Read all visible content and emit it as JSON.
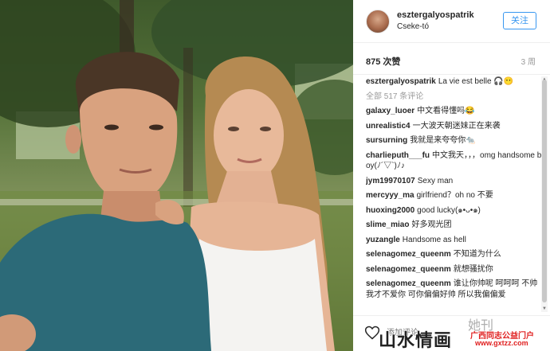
{
  "post": {
    "username": "esztergalyospatrik",
    "location": "Cseke-tó",
    "follow_label": "关注",
    "likes": "875 次赞",
    "time": "3 周"
  },
  "caption": {
    "username": "esztergalyospatrik",
    "text": "La vie est belle 🎧😶"
  },
  "view_all": "全部 517 条评论",
  "comments": [
    {
      "user": "galaxy_luoer",
      "text": "中文看得懂吗😂"
    },
    {
      "user": "unrealistic4",
      "text": "一大波天朝迷妹正在来袭"
    },
    {
      "user": "sursurning",
      "text": "我就是来夸夸你🐀"
    },
    {
      "user": "charlieputh___fu",
      "text": "中文我天，，，omg handsome boy(ﾉ´▽`)ﾉ♪"
    },
    {
      "user": "jym19970107",
      "text": "Sexy man"
    },
    {
      "user": "mercyyy_ma",
      "text": "girlfriend？oh no 不要"
    },
    {
      "user": "huoxing2000",
      "text": "good lucky(๑•ᴗ•๑)"
    },
    {
      "user": "slime_miao",
      "text": "好多观光团"
    },
    {
      "user": "yuzangle",
      "text": "Handsome as hell"
    },
    {
      "user": "selenagomez_queenm",
      "text": "不知道为什么"
    },
    {
      "user": "selenagomez_queenm",
      "text": "就想骚扰你"
    },
    {
      "user": "selenagomez_queenm",
      "text": "谁让你帅呢 呵呵呵 不帅我才不爱你 可你偏偏好帅 所以我偏偏爱"
    }
  ],
  "footer": {
    "comment_placeholder": "添加评论..."
  },
  "watermarks": {
    "main": "山水情画",
    "logo": "她刊",
    "site": "广西同志公益门户",
    "url": "www.gxtzz.com"
  },
  "icons": [
    "heart-icon",
    "scroll-up-arrow",
    "scroll-down-arrow"
  ],
  "colors": {
    "follow": "#3897f0",
    "watermark_red": "#e02020"
  }
}
